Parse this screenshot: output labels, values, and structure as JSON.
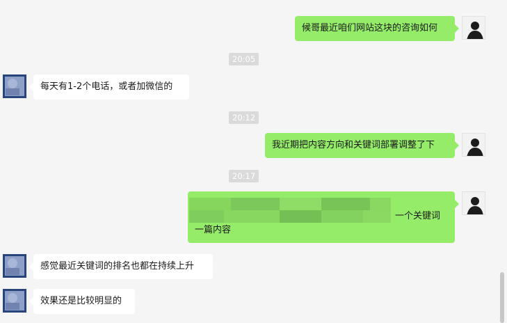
{
  "messages": [
    {
      "side": "me",
      "text": "候哥最近咱们网站这块的咨询如何"
    },
    {
      "side": "time",
      "text": "20:05"
    },
    {
      "side": "them",
      "text": "每天有1-2个电话，或者加微信的"
    },
    {
      "side": "time",
      "text": "20:12"
    },
    {
      "side": "me",
      "text": "我近期把内容方向和关键词部署调整了下"
    },
    {
      "side": "time",
      "text": "20:17"
    },
    {
      "side": "me",
      "line1_tail": "一个关键词",
      "line2": "一篇内容"
    },
    {
      "side": "them",
      "text": "感觉最近关键词的排名也都在持续上升"
    },
    {
      "side": "them",
      "text": "效果还是比较明显的"
    }
  ]
}
